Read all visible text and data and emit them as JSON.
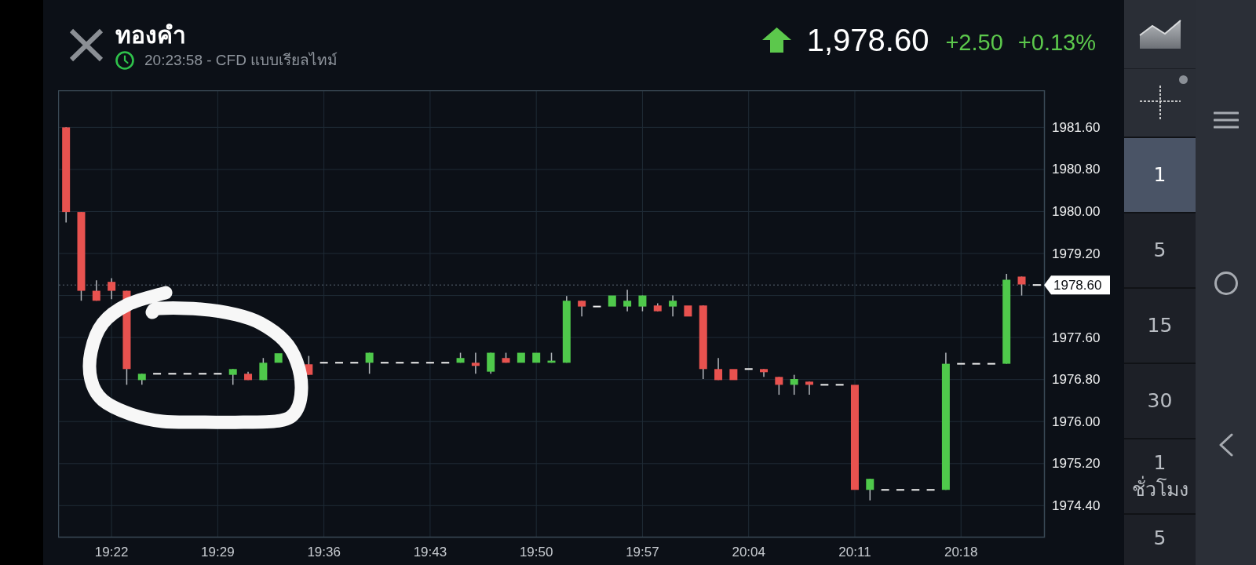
{
  "header": {
    "title": "ทองคำ",
    "status": "20:23:58 - CFD แบบเรียลไทม์"
  },
  "quote": {
    "rising": true,
    "price": "1,978.60",
    "change": "+2.50",
    "percent_change": "+0.13%"
  },
  "chart": {
    "chart_data": {
      "type": "candlestick",
      "x": [
        1159,
        1160,
        1161,
        1162,
        1163,
        1164,
        1165,
        1166,
        1167,
        1168,
        1169,
        1170,
        1171,
        1172,
        1173,
        1175,
        1176,
        1177,
        1178,
        1179,
        1180,
        1181,
        1182,
        1183,
        1184,
        1185,
        1186,
        1187,
        1188,
        1189,
        1190,
        1191,
        1192,
        1193,
        1194,
        1195,
        1196,
        1197,
        1198,
        1199,
        1200,
        1201,
        1202,
        1203,
        1204,
        1205,
        1206,
        1207,
        1208,
        1209,
        1210,
        1211,
        1212,
        1213,
        1214,
        1215,
        1216,
        1217,
        1218,
        1219,
        1220,
        1221,
        1222,
        1223
      ],
      "ohlc": [
        [
          1981.6,
          1981.6,
          1979.79,
          1979.99
        ],
        [
          1979.99,
          1979.99,
          1978.3,
          1978.49
        ],
        [
          1978.49,
          1978.69,
          1978.3,
          1978.3
        ],
        [
          1978.66,
          1978.73,
          1978.33,
          1978.49
        ],
        [
          1978.49,
          1978.49,
          1976.7,
          1977.0
        ],
        [
          1976.79,
          1976.91,
          1976.7,
          1976.91
        ],
        [
          1976.91,
          1976.91,
          1976.91,
          1976.91
        ],
        [
          1976.91,
          1976.91,
          1976.91,
          1976.91
        ],
        [
          1976.91,
          1976.91,
          1976.91,
          1976.91
        ],
        [
          1976.91,
          1976.91,
          1976.91,
          1976.91
        ],
        [
          1976.91,
          1976.91,
          1976.91,
          1976.91
        ],
        [
          1976.89,
          1977.0,
          1976.7,
          1977.0
        ],
        [
          1976.91,
          1976.95,
          1976.79,
          1976.79
        ],
        [
          1976.79,
          1977.21,
          1976.79,
          1977.12
        ],
        [
          1977.12,
          1977.3,
          1977.12,
          1977.3
        ],
        [
          1977.09,
          1977.25,
          1976.89,
          1976.89
        ],
        [
          1977.12,
          1977.12,
          1977.12,
          1977.12
        ],
        [
          1977.12,
          1977.12,
          1977.12,
          1977.12
        ],
        [
          1977.12,
          1977.12,
          1977.12,
          1977.12
        ],
        [
          1977.12,
          1977.31,
          1976.91,
          1977.31
        ],
        [
          1977.12,
          1977.12,
          1977.12,
          1977.12
        ],
        [
          1977.12,
          1977.12,
          1977.12,
          1977.12
        ],
        [
          1977.12,
          1977.12,
          1977.12,
          1977.12
        ],
        [
          1977.12,
          1977.12,
          1977.12,
          1977.12
        ],
        [
          1977.12,
          1977.12,
          1977.12,
          1977.12
        ],
        [
          1977.12,
          1977.31,
          1977.12,
          1977.21
        ],
        [
          1977.12,
          1977.31,
          1976.91,
          1977.06
        ],
        [
          1976.95,
          1977.31,
          1976.91,
          1977.31
        ],
        [
          1977.21,
          1977.31,
          1977.12,
          1977.12
        ],
        [
          1977.12,
          1977.31,
          1977.12,
          1977.31
        ],
        [
          1977.12,
          1977.31,
          1977.12,
          1977.31
        ],
        [
          1977.12,
          1977.31,
          1977.12,
          1977.16
        ],
        [
          1977.12,
          1978.39,
          1977.12,
          1978.3
        ],
        [
          1978.3,
          1978.3,
          1978.0,
          1978.19
        ],
        [
          1978.19,
          1978.19,
          1978.19,
          1978.19
        ],
        [
          1978.19,
          1978.4,
          1978.19,
          1978.4
        ],
        [
          1978.19,
          1978.51,
          1978.1,
          1978.3
        ],
        [
          1978.19,
          1978.4,
          1978.1,
          1978.4
        ],
        [
          1978.21,
          1978.25,
          1978.1,
          1978.1
        ],
        [
          1978.19,
          1978.4,
          1978.0,
          1978.3
        ],
        [
          1978.21,
          1978.21,
          1978.0,
          1978.0
        ],
        [
          1978.21,
          1978.21,
          1976.81,
          1977.0
        ],
        [
          1977.0,
          1977.21,
          1976.79,
          1976.79
        ],
        [
          1977.0,
          1977.0,
          1976.79,
          1976.79
        ],
        [
          1977.0,
          1977.0,
          1977.0,
          1977.0
        ],
        [
          1977.0,
          1977.0,
          1976.85,
          1976.94
        ],
        [
          1976.85,
          1976.85,
          1976.51,
          1976.7
        ],
        [
          1976.7,
          1976.89,
          1976.51,
          1976.81
        ],
        [
          1976.76,
          1976.76,
          1976.51,
          1976.7
        ],
        [
          1976.7,
          1976.7,
          1976.7,
          1976.7
        ],
        [
          1976.7,
          1976.7,
          1976.7,
          1976.7
        ],
        [
          1976.7,
          1976.7,
          1974.7,
          1974.7
        ],
        [
          1974.7,
          1974.91,
          1974.5,
          1974.91
        ],
        [
          1974.7,
          1974.7,
          1974.7,
          1974.7
        ],
        [
          1974.7,
          1974.7,
          1974.7,
          1974.7
        ],
        [
          1974.7,
          1974.7,
          1974.7,
          1974.7
        ],
        [
          1974.7,
          1974.7,
          1974.7,
          1974.7
        ],
        [
          1974.7,
          1977.31,
          1974.7,
          1977.1
        ],
        [
          1977.1,
          1977.1,
          1977.1,
          1977.1
        ],
        [
          1977.1,
          1977.1,
          1977.1,
          1977.1
        ],
        [
          1977.1,
          1977.1,
          1977.1,
          1977.1
        ],
        [
          1977.1,
          1978.81,
          1977.1,
          1978.7
        ],
        [
          1978.76,
          1978.76,
          1978.4,
          1978.61
        ],
        [
          1978.6,
          1978.6,
          1978.6,
          1978.6
        ]
      ],
      "xlim": [
        1158.5,
        1223.5
      ],
      "ylim": [
        1973.8,
        1982.3
      ],
      "grid": true,
      "yticks": [
        {
          "value": 1981.6,
          "label": "1981.60"
        },
        {
          "value": 1980.8,
          "label": "1980.80"
        },
        {
          "value": 1980.0,
          "label": "1980.00"
        },
        {
          "value": 1979.2,
          "label": "1979.20"
        },
        {
          "value": 1977.6,
          "label": "1977.60"
        },
        {
          "value": 1976.8,
          "label": "1976.80"
        },
        {
          "value": 1976.0,
          "label": "1976.00"
        },
        {
          "value": 1975.2,
          "label": "1975.20"
        },
        {
          "value": 1974.4,
          "label": "1974.40"
        }
      ],
      "xticks": [
        {
          "value": 1162,
          "label": "19:22"
        },
        {
          "value": 1169,
          "label": "19:29"
        },
        {
          "value": 1176,
          "label": "19:36"
        },
        {
          "value": 1183,
          "label": "19:43"
        },
        {
          "value": 1190,
          "label": "19:50"
        },
        {
          "value": 1197,
          "label": "19:57"
        },
        {
          "value": 1204,
          "label": "20:04"
        },
        {
          "value": 1211,
          "label": "20:11"
        },
        {
          "value": 1218,
          "label": "20:18"
        }
      ],
      "ref_lines": [
        {
          "axis": "y",
          "value": 1978.6,
          "label": "1978.60"
        }
      ]
    }
  },
  "timeframes": [
    {
      "kind": "minutes",
      "value": "1",
      "selected": true
    },
    {
      "kind": "minutes",
      "value": "5",
      "selected": false
    },
    {
      "kind": "minutes",
      "value": "15",
      "selected": false
    },
    {
      "kind": "minutes",
      "value": "30",
      "selected": false
    },
    {
      "kind": "hours",
      "value": "1",
      "unit": "ชั่วโมง",
      "selected": false
    },
    {
      "kind": "hours",
      "value": "5",
      "selected": false
    }
  ]
}
